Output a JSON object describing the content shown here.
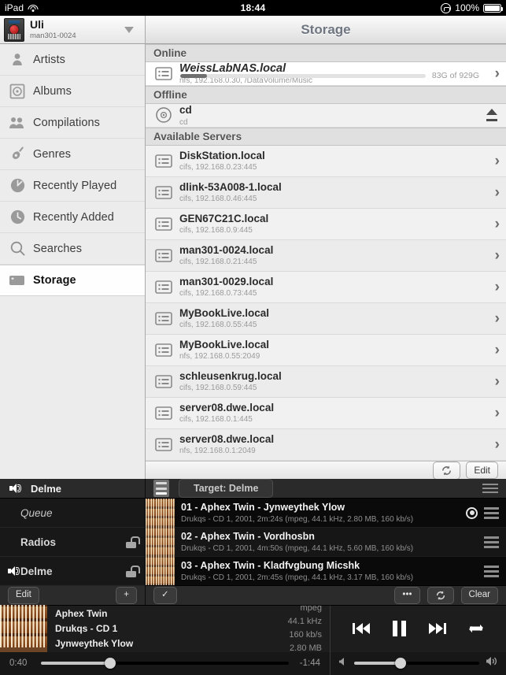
{
  "status_bar": {
    "device": "iPad",
    "wifi_icon": "wifi-icon",
    "time": "18:44",
    "rotation_lock_icon": "rotation-lock-icon",
    "battery_percent": "100%",
    "battery_icon": "battery-full-icon"
  },
  "device_header": {
    "name": "Uli",
    "subtitle": "man301-0024",
    "icon": "device-icon",
    "disclosure_icon": "chevron-down-icon"
  },
  "title": "Storage",
  "sidebar": {
    "items": [
      {
        "label": "Artists",
        "icon": "artist-icon",
        "selected": false
      },
      {
        "label": "Albums",
        "icon": "album-disc-icon",
        "selected": false
      },
      {
        "label": "Compilations",
        "icon": "compilations-icon",
        "selected": false
      },
      {
        "label": "Genres",
        "icon": "guitar-icon",
        "selected": false
      },
      {
        "label": "Recently Played",
        "icon": "recently-played-icon",
        "selected": false
      },
      {
        "label": "Recently Added",
        "icon": "recently-added-icon",
        "selected": false
      },
      {
        "label": "Searches",
        "icon": "search-icon",
        "selected": false
      },
      {
        "label": "Storage",
        "icon": "storage-icon",
        "selected": true
      }
    ]
  },
  "storage": {
    "sections": [
      {
        "header": "Online"
      },
      {
        "header": "Offline"
      },
      {
        "header": "Available Servers"
      }
    ],
    "online": [
      {
        "name": "WeissLabNAS.local",
        "detail": "nfs, 192.168.0.30, /DataVolume/Music",
        "usage_label": "83G of 929G",
        "usage_percent": 11,
        "icon": "server-icon",
        "accessory": "chevron-right-icon"
      }
    ],
    "offline": [
      {
        "name": "cd",
        "detail": "cd",
        "icon": "disc-icon",
        "accessory": "eject-icon"
      }
    ],
    "available_servers": [
      {
        "name": "DiskStation.local",
        "detail": "cifs, 192.168.0.23:445",
        "icon": "server-icon",
        "accessory": "chevron-right-icon"
      },
      {
        "name": "dlink-53A008-1.local",
        "detail": "cifs, 192.168.0.46:445",
        "icon": "server-icon",
        "accessory": "chevron-right-icon"
      },
      {
        "name": "GEN67C21C.local",
        "detail": "cifs, 192.168.0.9:445",
        "icon": "server-icon",
        "accessory": "chevron-right-icon"
      },
      {
        "name": "man301-0024.local",
        "detail": "cifs, 192.168.0.21:445",
        "icon": "server-icon",
        "accessory": "chevron-right-icon"
      },
      {
        "name": "man301-0029.local",
        "detail": "cifs, 192.168.0.73:445",
        "icon": "server-icon",
        "accessory": "chevron-right-icon"
      },
      {
        "name": "MyBookLive.local",
        "detail": "cifs, 192.168.0.55:445",
        "icon": "server-icon",
        "accessory": "chevron-right-icon"
      },
      {
        "name": "MyBookLive.local",
        "detail": "nfs, 192.168.0.55:2049",
        "icon": "server-icon",
        "accessory": "chevron-right-icon"
      },
      {
        "name": "schleusenkrug.local",
        "detail": "cifs, 192.168.0.59:445",
        "icon": "server-icon",
        "accessory": "chevron-right-icon"
      },
      {
        "name": "server08.dwe.local",
        "detail": "cifs, 192.168.0.1:445",
        "icon": "server-icon",
        "accessory": "chevron-right-icon"
      },
      {
        "name": "server08.dwe.local",
        "detail": "nfs, 192.168.0.1:2049",
        "icon": "server-icon",
        "accessory": "chevron-right-icon"
      }
    ],
    "footer": {
      "refresh_icon": "refresh-icon",
      "edit_label": "Edit"
    }
  },
  "player": {
    "header": {
      "speaker_icon": "speaker-icon",
      "zone_name": "Delme",
      "list_icon": "playlist-icon",
      "target_label": "Target: Delme",
      "menu_icon": "hamburger-menu-icon"
    },
    "zones": [
      {
        "label": "Queue",
        "icon": "",
        "lock": false,
        "italic": true
      },
      {
        "label": "Radios",
        "icon": "",
        "lock": true,
        "italic": false
      },
      {
        "label": "Delme",
        "icon": "speaker-icon",
        "lock": true,
        "italic": false
      }
    ],
    "queue": [
      {
        "title": "01 - Aphex Twin - Jynweythek Ylow",
        "detail": "Drukqs - CD 1, 2001,  2m:24s (mpeg, 44.1 kHz, 2.80 MB, 160 kb/s)",
        "now_playing": true,
        "grip_icon": "drag-handle-icon",
        "now_playing_icon": "now-playing-icon"
      },
      {
        "title": "02 - Aphex Twin - Vordhosbn",
        "detail": "Drukqs - CD 1, 2001,  4m:50s (mpeg, 44.1 kHz, 5.60 MB, 160 kb/s)",
        "now_playing": false,
        "grip_icon": "drag-handle-icon"
      },
      {
        "title": "03 - Aphex Twin - Kladfvgbung Micshk",
        "detail": "Drukqs - CD 1, 2001,  2m:45s (mpeg, 44.1 kHz, 3.17 MB, 160 kb/s)",
        "now_playing": false,
        "grip_icon": "drag-handle-icon"
      }
    ],
    "toolbar": {
      "edit_label": "Edit",
      "add_label": "+",
      "check_label": "✓",
      "more_label": "•••",
      "refresh_icon": "refresh-icon",
      "clear_label": "Clear"
    },
    "now_playing": {
      "artwork": "album-artwork",
      "artist": "Aphex Twin",
      "album": "Drukqs - CD 1",
      "track": "Jynweythek Ylow",
      "format": "mpeg",
      "samplerate": "44.1 kHz",
      "bitrate": "160 kb/s",
      "filesize": "2.80 MB",
      "controls": {
        "previous_icon": "previous-track-icon",
        "pause_icon": "pause-icon",
        "next_icon": "next-track-icon",
        "repeat_icon": "repeat-icon"
      }
    },
    "seek": {
      "elapsed": "0:40",
      "remaining": "-1:44",
      "progress_percent": 28,
      "volume_percent": 37,
      "volume_min_icon": "volume-low-icon",
      "volume_max_icon": "volume-high-icon"
    }
  }
}
